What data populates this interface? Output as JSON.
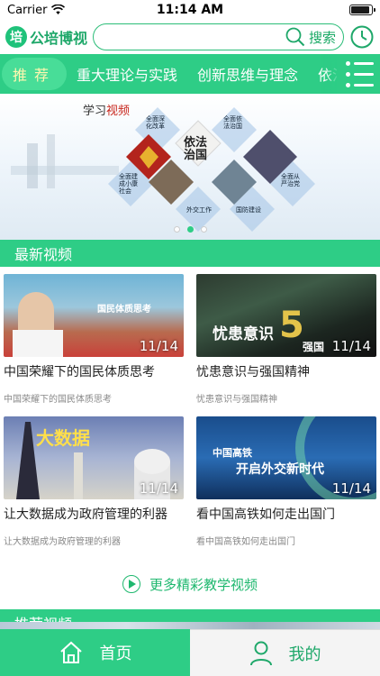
{
  "status_bar": {
    "carrier": "Carrier",
    "time": "11:14 AM",
    "battery_level": 0.9
  },
  "header": {
    "logo_badge": "培",
    "logo_text": "公培博视",
    "search_label": "搜索",
    "history_icon": "clock-icon"
  },
  "tabs": [
    {
      "label": "推荐",
      "active": true
    },
    {
      "label": "重大理论与实践",
      "active": false
    },
    {
      "label": "创新思维与理念",
      "active": false
    },
    {
      "label": "依法",
      "active": false
    }
  ],
  "banner": {
    "title_prefix": "学习",
    "title_suffix": "视频",
    "center_text": "依法治国",
    "tiles": [
      "全面深化改革",
      "全面依法治国",
      "全面建成小康社会",
      "全面从严治党",
      "外交工作",
      "国防建设"
    ],
    "page_count": 3,
    "active_page": 2
  },
  "latest_section": {
    "title": "最新视频"
  },
  "videos": [
    {
      "title": "中国荣耀下的国民体质思考",
      "subtitle": "中国荣耀下的国民体质思考",
      "date": "11/14",
      "thumb_text": "国民体质思考"
    },
    {
      "title": "忧患意识与强国精神",
      "subtitle": "忧患意识与强国精神",
      "date": "11/14",
      "thumb_text": "忧患意识",
      "thumb_number": "5",
      "thumb_text2": "强国"
    },
    {
      "title": "让大数据成为政府管理的利器",
      "subtitle": "让大数据成为政府管理的利器",
      "date": "11/14",
      "thumb_text": "大数据"
    },
    {
      "title": "看中国高铁如何走出国门",
      "subtitle": "看中国高铁如何走出国门",
      "date": "11/14",
      "thumb_text": "中国高铁",
      "thumb_text2": "开启外交新时代"
    }
  ],
  "more_link": {
    "label": "更多精彩教学视频"
  },
  "recommended_section": {
    "title": "推荐视频"
  },
  "bottom_nav": {
    "home_label": "首页",
    "mine_label": "我的"
  },
  "colors": {
    "brand_green": "#2ecd86",
    "text_dark": "#222222",
    "subtitle_gray": "#888888"
  }
}
